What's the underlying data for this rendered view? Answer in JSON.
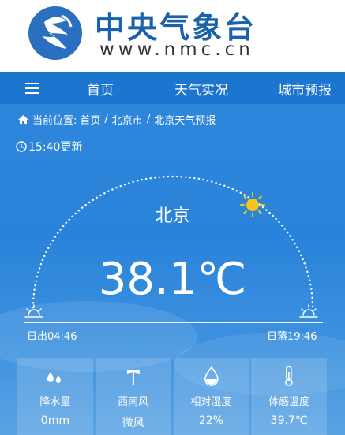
{
  "site": {
    "title": "中央气象台",
    "url": "www.nmc.cn"
  },
  "nav": {
    "items": [
      "首页",
      "天气实况",
      "城市预报"
    ]
  },
  "breadcrumb": {
    "prefix": "当前位置:",
    "items": [
      "首页",
      "北京市",
      "北京天气预报"
    ]
  },
  "update_time": "15:40更新",
  "weather": {
    "city": "北京",
    "temperature": "38.1℃",
    "sunrise": "日出04:46",
    "sunset": "日落19:46"
  },
  "stats": [
    {
      "icon": "raindrop-icon",
      "label": "降水量",
      "value": "0mm"
    },
    {
      "icon": "wind-vane-icon",
      "label": "西南风",
      "value": "微风"
    },
    {
      "icon": "humidity-icon",
      "label": "相对湿度",
      "value": "22%"
    },
    {
      "icon": "thermometer-icon",
      "label": "体感温度",
      "value": "39.7℃"
    }
  ],
  "colors": {
    "brand": "#1b62ac",
    "nav": "#1c76cf",
    "sky": "#2f87dc",
    "sun": "#f5c518"
  }
}
